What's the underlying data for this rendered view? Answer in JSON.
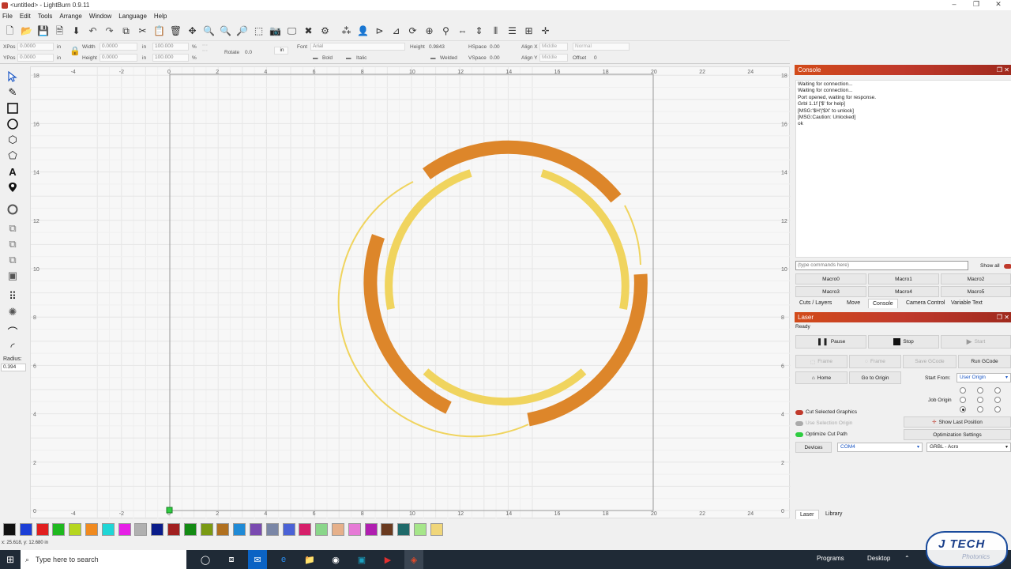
{
  "window": {
    "title": "<untitled> - LightBurn 0.9.11",
    "controls": [
      "–",
      "❐",
      "✕"
    ]
  },
  "menu": [
    "File",
    "Edit",
    "Tools",
    "Arrange",
    "Window",
    "Language",
    "Help"
  ],
  "props": {
    "xpos_label": "XPos",
    "xpos_value": "0.0000",
    "ypos_label": "YPos",
    "ypos_value": "0.0000",
    "unit_in": "in",
    "width_label": "Width",
    "width_value": "0.0000",
    "height_label": "Height",
    "height_value": "0.0000",
    "scale_w": "100.000",
    "scale_h": "100.000",
    "pct": "%",
    "rotate_label": "Rotate",
    "rotate_value": "0.0",
    "units_btn": "in",
    "font_label": "Font",
    "font_value": "Arial",
    "fheight_label": "Height",
    "fheight_value": "0.9843",
    "bold": "Bold",
    "italic": "Italic",
    "hspace_label": "HSpace",
    "hspace_value": "0.00",
    "vspace_label": "VSpace",
    "vspace_value": "0.00",
    "welded": "Welded",
    "alignx_label": "Align X",
    "alignx_value": "Middle",
    "aligny_label": "Align Y",
    "aligny_value": "Middle",
    "mode_value": "Normal",
    "offset_label": "Offset",
    "offset_value": "0"
  },
  "left_tools": {
    "radius_label": "Radius:",
    "radius_value": "0.394"
  },
  "ruler": {
    "top": [
      "-4",
      "-2",
      "0",
      "2",
      "4",
      "6",
      "8",
      "10",
      "12",
      "14",
      "16",
      "18",
      "20",
      "22",
      "24"
    ],
    "left": [
      "18",
      "16",
      "14",
      "12",
      "10",
      "8",
      "6",
      "4",
      "2",
      "0"
    ]
  },
  "palette": [
    "#111111",
    "#1c3fd6",
    "#e11f1f",
    "#1fb81f",
    "#b6d61f",
    "#f08a1f",
    "#1fd6d6",
    "#e61fe6",
    "#b0b0b0",
    "#0a1c8a",
    "#a01f1f",
    "#138a13",
    "#7a9a13",
    "#b0701f",
    "#1f8ad6",
    "#7a4ab0",
    "#7a86a6",
    "#4a62d6",
    "#d61f6a",
    "#8ad68a",
    "#e6b08a",
    "#e67ad6",
    "#b01fb0",
    "#6a3a1f",
    "#1f6a6a",
    "#a6e68a",
    "#f0d67a"
  ],
  "status": "x: 25.618, y: 12.680 in",
  "console": {
    "title": "Console",
    "lines": [
      "Waiting for connection...",
      "Waiting for connection...",
      "Port opened, waiting for response.",
      "Grbl 1.1f ['$' for help]",
      "[MSG:'$H'|'$X' to unlock]",
      "[MSG:Caution: Unlocked]",
      "ok"
    ],
    "cmd_placeholder": "(type commands here)",
    "show_all": "Show all",
    "macros": [
      "Macro0",
      "Macro1",
      "Macro2",
      "Macro3",
      "Macro4",
      "Macro5"
    ],
    "tabs": [
      "Cuts / Layers",
      "Move",
      "Console",
      "Camera Control",
      "Variable Text"
    ]
  },
  "laser": {
    "title": "Laser",
    "state": "Ready",
    "pause": "Pause",
    "stop": "Stop",
    "start": "Start",
    "frame1": "Frame",
    "frame2": "Frame",
    "save_gcode": "Save GCode",
    "run_gcode": "Run GCode",
    "home": "Home",
    "go_origin": "Go to Origin",
    "start_from_label": "Start From:",
    "start_from_value": "User Origin",
    "job_origin_label": "Job Origin",
    "cut_selected": "Cut Selected Graphics",
    "use_selection_origin": "Use Selection Origin",
    "optimize_cut": "Optimize Cut Path",
    "show_last": "Show Last Position",
    "opt_settings": "Optimization Settings",
    "devices": "Devices",
    "port": "COM4",
    "profile": "GRBL - Acro",
    "bottom_tabs": [
      "Laser",
      "Library"
    ]
  },
  "taskbar": {
    "search_placeholder": "Type here to search",
    "programs": "Programs",
    "desktop": "Desktop",
    "logo_text": "J TECH",
    "logo_sub": "Photonics"
  },
  "colors": {
    "orange": "#dd862a",
    "yellow": "#f0d45e"
  }
}
